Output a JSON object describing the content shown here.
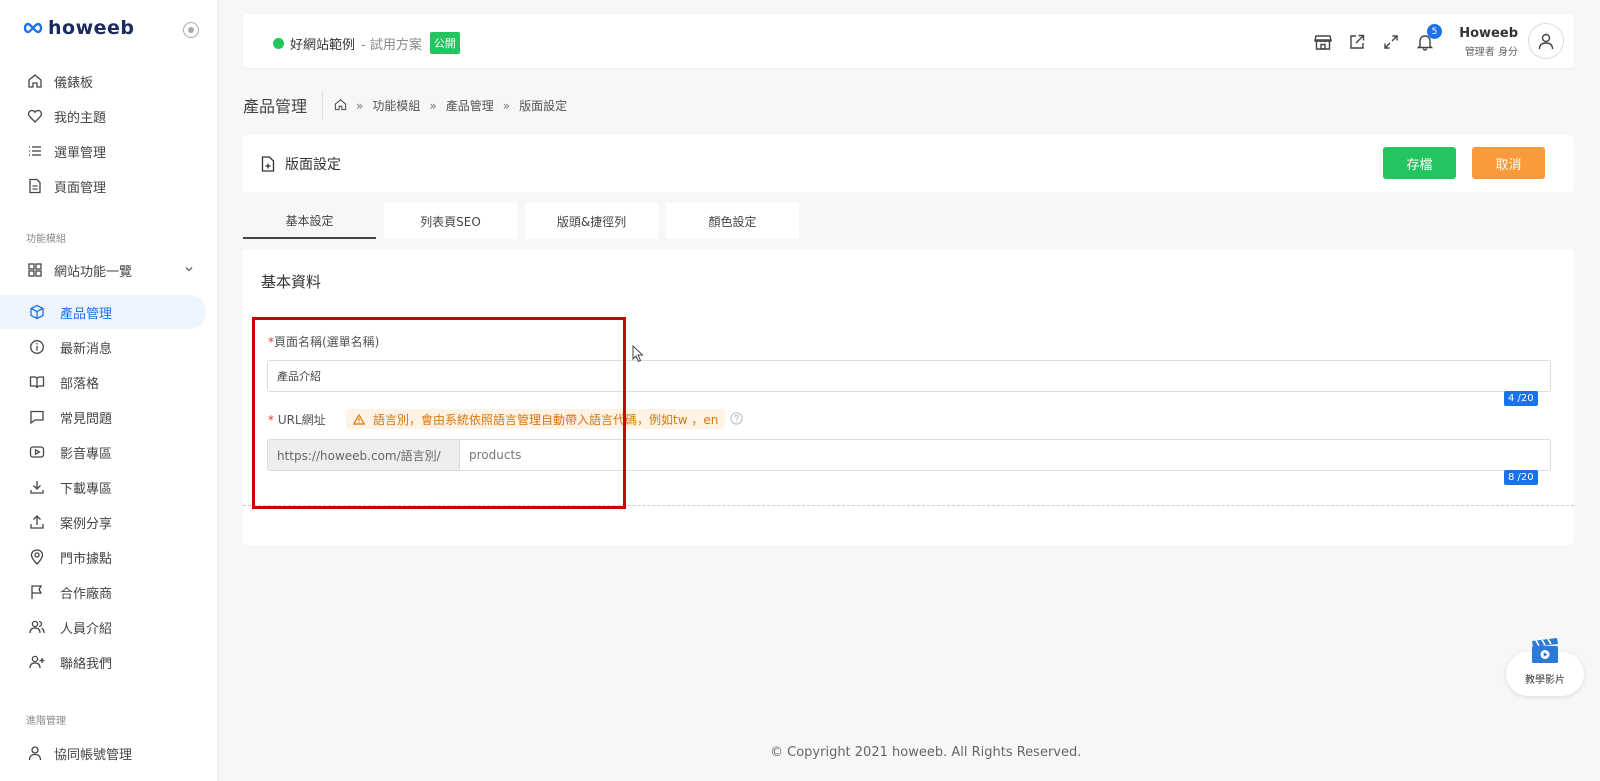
{
  "brand": {
    "logo_text": "howeeb"
  },
  "sidebar": {
    "items": [
      {
        "label": "儀錶板",
        "icon": "home-icon"
      },
      {
        "label": "我的主題",
        "icon": "heart-icon"
      },
      {
        "label": "選單管理",
        "icon": "list-icon"
      },
      {
        "label": "頁面管理",
        "icon": "document-icon"
      }
    ],
    "section_modules": "功能模組",
    "group_label": "網站功能一覽",
    "sub_items": [
      {
        "label": "產品管理",
        "icon": "box-icon",
        "active": true
      },
      {
        "label": "最新消息",
        "icon": "info-icon"
      },
      {
        "label": "部落格",
        "icon": "book-icon"
      },
      {
        "label": "常見問題",
        "icon": "chat-icon"
      },
      {
        "label": "影音專區",
        "icon": "video-icon"
      },
      {
        "label": "下載專區",
        "icon": "download-icon"
      },
      {
        "label": "案例分享",
        "icon": "share-icon"
      },
      {
        "label": "門市據點",
        "icon": "location-icon"
      },
      {
        "label": "合作廠商",
        "icon": "flag-icon"
      },
      {
        "label": "人員介紹",
        "icon": "users-icon"
      },
      {
        "label": "聯絡我們",
        "icon": "user-plus-icon"
      }
    ],
    "section_advanced": "進階管理",
    "advanced_items": [
      {
        "label": "協同帳號管理",
        "icon": "user-icon"
      }
    ]
  },
  "header": {
    "site_name": "好網站範例",
    "site_plan": "- 試用方案",
    "public_badge": "公開",
    "notification_count": "5",
    "user_name": "Howeeb",
    "user_role": "管理者 身分"
  },
  "breadcrumb": {
    "page_title": "產品管理",
    "items": [
      "功能模組",
      "產品管理",
      "版面設定"
    ],
    "separator": "»"
  },
  "toolbar": {
    "title": "版面設定",
    "save_label": "存檔",
    "cancel_label": "取消"
  },
  "tabs": [
    {
      "label": "基本設定",
      "active": true
    },
    {
      "label": "列表頁SEO"
    },
    {
      "label": "版頭&捷徑列"
    },
    {
      "label": "顏色設定"
    }
  ],
  "form": {
    "section_title": "基本資料",
    "page_name": {
      "required_mark": "*",
      "label": "頁面名稱(選單名稱)",
      "value": "產品介紹",
      "counter": "4 /20"
    },
    "url": {
      "required_mark": "*",
      "label": " URL網址",
      "hint": "語言別，會由系統依照語言管理自動帶入語言代碼，例如tw ，en",
      "prefix": "https://howeeb.com/語言別/",
      "value": "products",
      "counter": "8 /20"
    }
  },
  "footer": {
    "copyright": "© Copyright 2021 howeeb. All Rights Reserved."
  },
  "widget": {
    "label": "教學影片"
  },
  "colors": {
    "accent": "#1a73e8",
    "success": "#22c55e",
    "warning": "#fb9a3a",
    "highlight": "#d10000"
  }
}
